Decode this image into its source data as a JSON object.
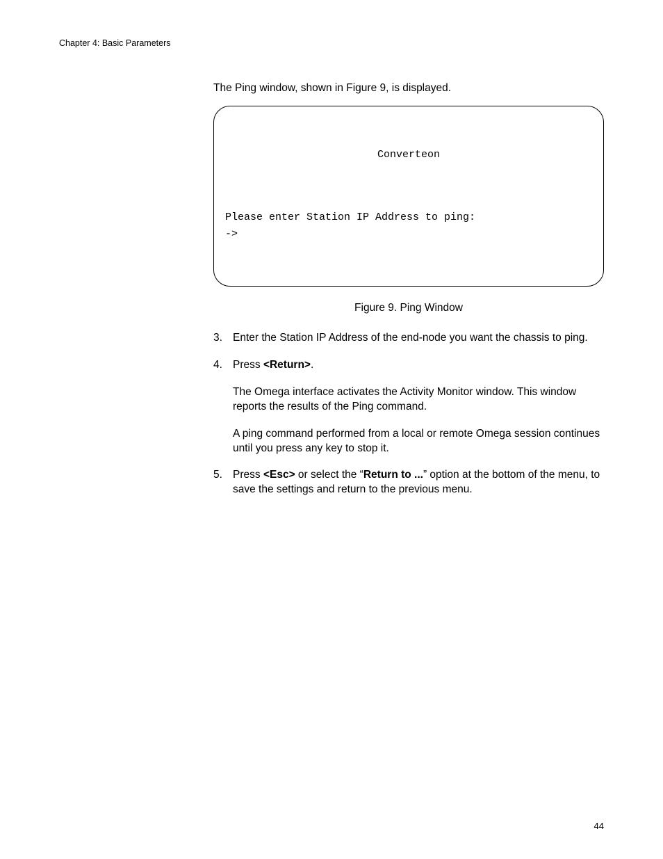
{
  "chapter_header": "Chapter 4: Basic Parameters",
  "intro": "The Ping window, shown in Figure 9, is displayed.",
  "terminal": {
    "title": "Converteon",
    "prompt_line": "Please enter Station IP Address to ping:",
    "cursor_line": "->"
  },
  "figure_caption": "Figure 9. Ping Window",
  "steps": {
    "s3": {
      "num": "3.",
      "text": "Enter the Station IP Address of the end-node you want the chassis to ping."
    },
    "s4": {
      "num": "4.",
      "press": "Press ",
      "key": "<Return>",
      "period": ".",
      "para1": "The Omega interface activates the Activity Monitor window. This window reports the results of the Ping command.",
      "para2": "A ping command performed from a local or remote Omega session continues until you press any key to stop it."
    },
    "s5": {
      "num": "5.",
      "pre": "Press ",
      "key": "<Esc>",
      "mid": " or select the “",
      "bold": "Return to ...",
      "post": "” option at the bottom of the menu, to save the settings and return to the previous menu."
    }
  },
  "page_number": "44"
}
